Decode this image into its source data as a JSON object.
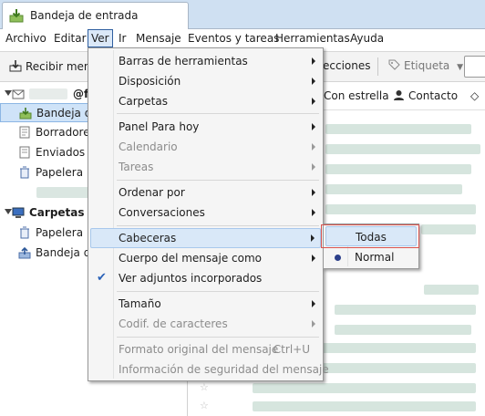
{
  "window": {
    "tab_title": "Bandeja de entrada"
  },
  "menubar": [
    "Archivo",
    "Editar",
    "Ver",
    "Ir",
    "Mensaje",
    "Eventos y tareas",
    "Herramientas",
    "Ayuda"
  ],
  "toolbar": {
    "receive": "Recibir mens",
    "collections": "ecciones",
    "tag": "Etiqueta"
  },
  "filterbar": {
    "starred": "Con estrella",
    "contact": "Contacto"
  },
  "folders": {
    "account_suffix": "@fi",
    "inbox": "Bandeja de",
    "drafts": "Borradores",
    "sent": "Enviados",
    "trash": "Papelera",
    "local_folders": "Carpetas loc",
    "local_trash": "Papelera",
    "local_outbox": "Bandeja de"
  },
  "view_menu": {
    "toolbars": "Barras de herramientas",
    "layout": "Disposición",
    "folders": "Carpetas",
    "today_pane": "Panel Para hoy",
    "calendar": "Calendario",
    "tasks": "Tareas",
    "sort_by": "Ordenar por",
    "threads": "Conversaciones",
    "headers": "Cabeceras",
    "message_body": "Cuerpo del mensaje como",
    "inline_attachments": "Ver adjuntos incorporados",
    "zoom": "Tamaño",
    "encoding": "Codif. de caracteres",
    "source": "Formato original del mensaje",
    "source_shortcut": "Ctrl+U",
    "security_info": "Información de seguridad del mensaje"
  },
  "headers_submenu": {
    "all": "Todas",
    "normal": "Normal"
  }
}
